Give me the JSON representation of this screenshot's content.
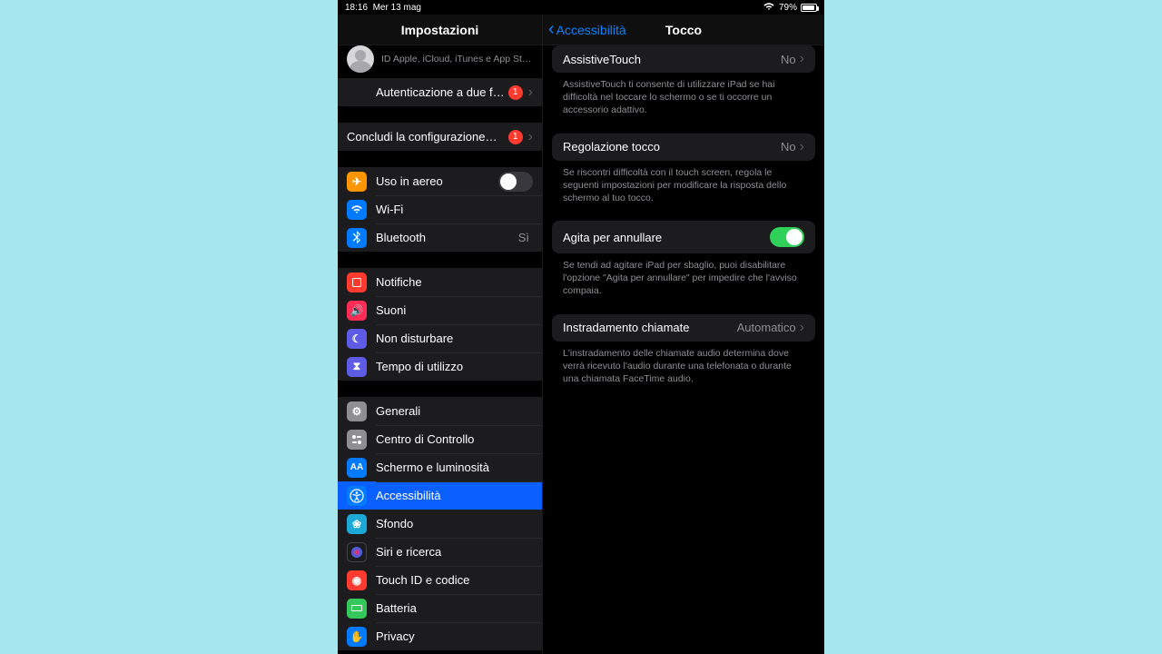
{
  "status": {
    "time": "18:16",
    "date": "Mer 13 mag",
    "battery_pct": "79%"
  },
  "left": {
    "title": "Impostazioni",
    "apple_id_sub": "ID Apple, iCloud, iTunes e App St…",
    "two_factor": "Autenticazione a due fattori",
    "finish_setup": "Concludi la configurazione…",
    "airplane": "Uso in aereo",
    "wifi": "Wi-Fi",
    "wifi_value": "",
    "bluetooth": "Bluetooth",
    "bluetooth_value": "Sì",
    "notifications": "Notifiche",
    "sounds": "Suoni",
    "dnd": "Non disturbare",
    "screentime": "Tempo di utilizzo",
    "general": "Generali",
    "control_center": "Centro di Controllo",
    "display": "Schermo e luminosità",
    "accessibility": "Accessibilità",
    "wallpaper": "Sfondo",
    "siri": "Siri e ricerca",
    "touchid": "Touch ID e codice",
    "battery": "Batteria",
    "privacy": "Privacy",
    "badge1": "1",
    "badge2": "1"
  },
  "right": {
    "back": "Accessibilità",
    "title": "Tocco",
    "assistive": "AssistiveTouch",
    "assistive_val": "No",
    "assistive_footer": "AssistiveTouch ti consente di utilizzare iPad se hai difficoltà nel toccare lo schermo o se ti occorre un accessorio adattivo.",
    "touch_accom": "Regolazione tocco",
    "touch_accom_val": "No",
    "touch_accom_footer": "Se riscontri difficoltà con il touch screen, regola le seguenti impostazioni per modificare la risposta dello schermo al tuo tocco.",
    "shake": "Agita per annullare",
    "shake_footer": "Se tendi ad agitare iPad per sbaglio, puoi disabilitare l'opzione \"Agita per annullare\" per impedire che l'avviso compaia.",
    "routing": "Instradamento chiamate",
    "routing_val": "Automatico",
    "routing_footer": "L'instradamento delle chiamate audio determina dove verrà ricevuto l'audio durante una telefonata o durante una chiamata FaceTime audio."
  }
}
